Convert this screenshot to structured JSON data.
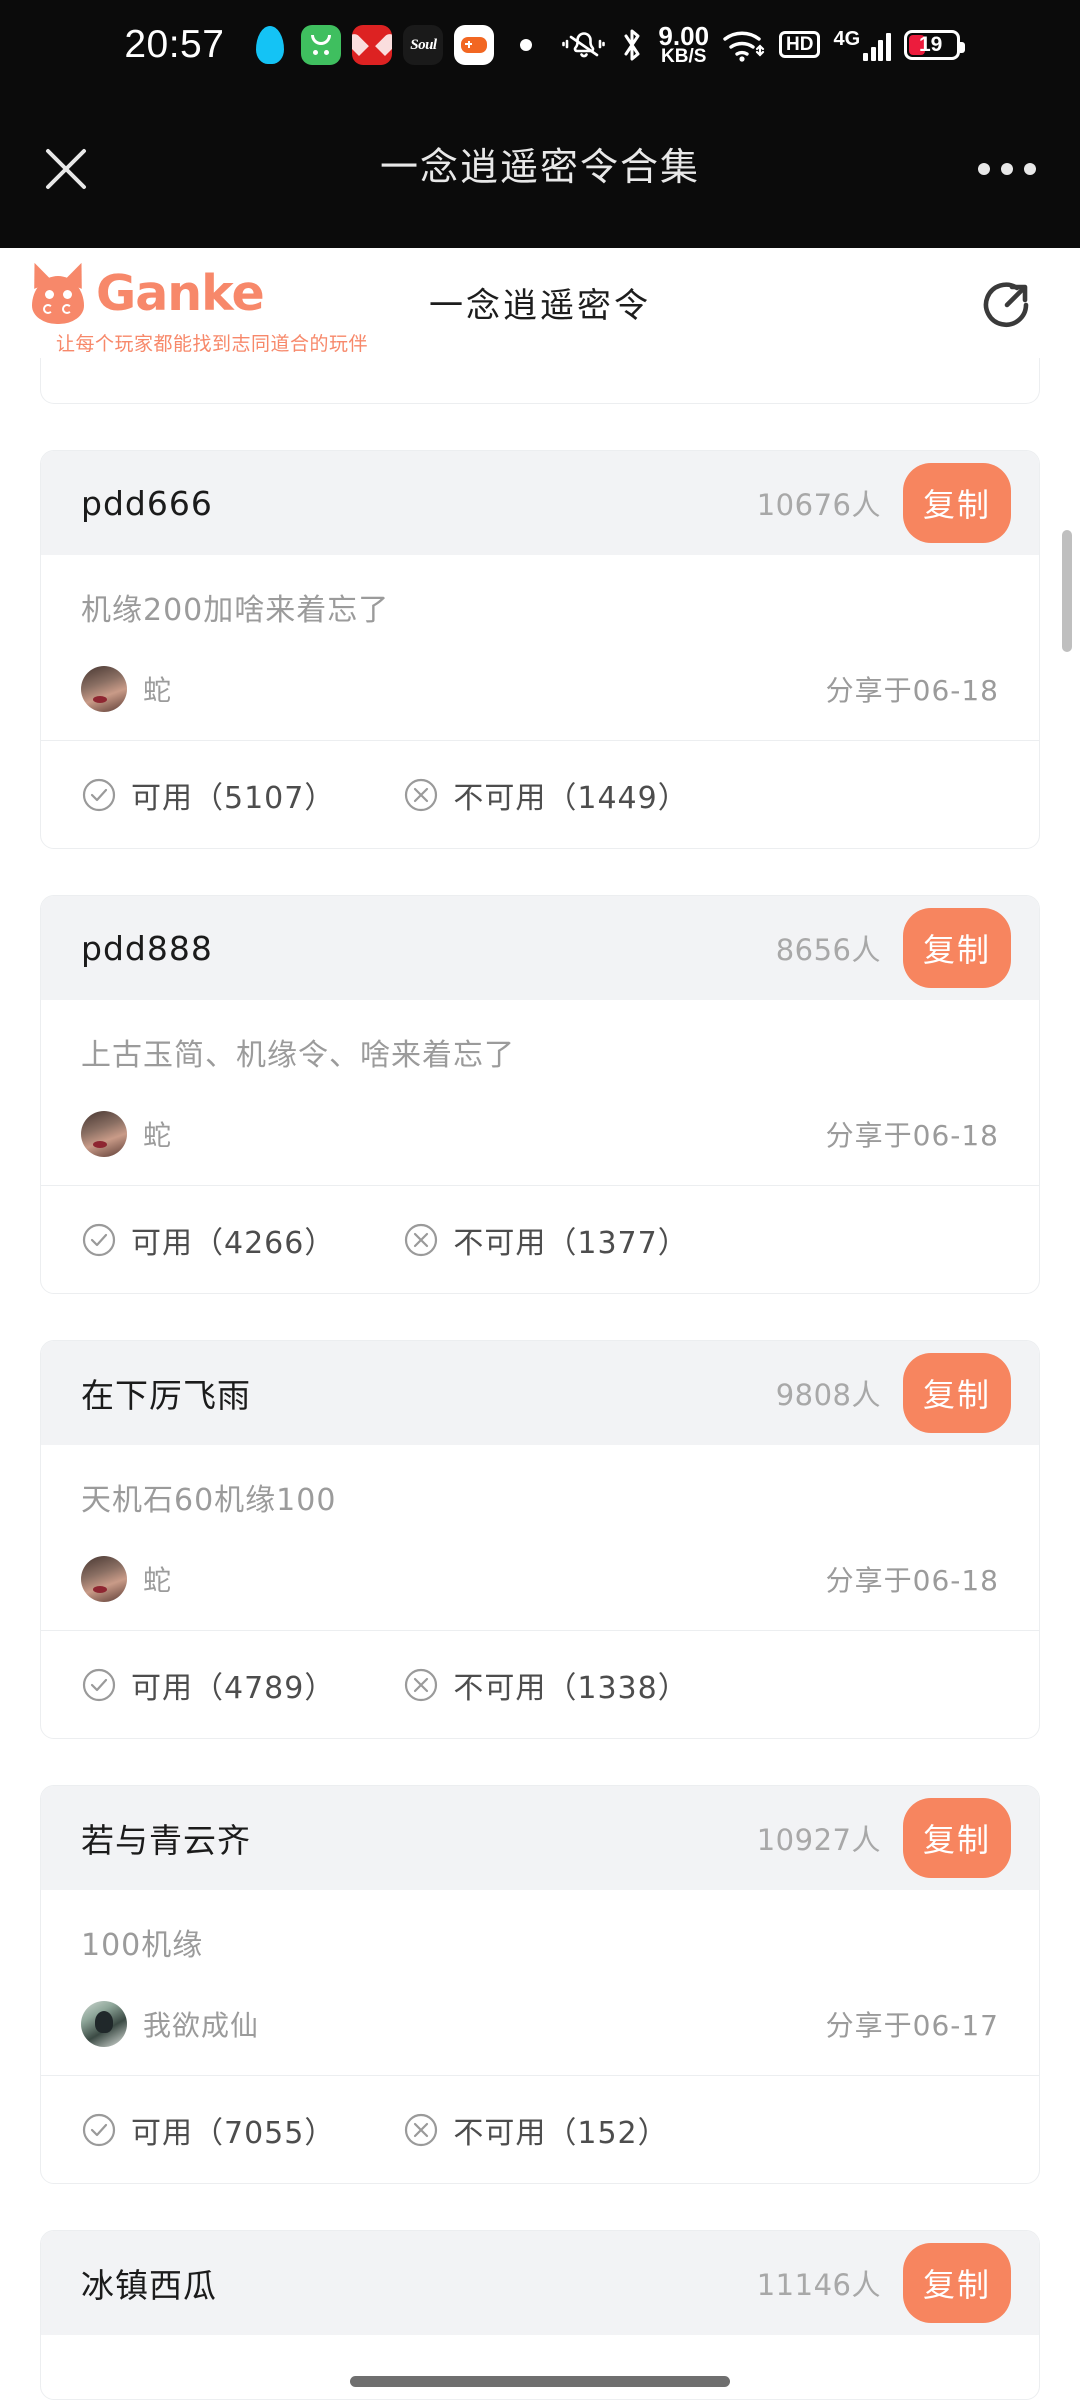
{
  "status_bar": {
    "time": "20:57",
    "app_icons": [
      "qq-icon",
      "wechat-icon",
      "xiaohongshu-icon",
      "soul-icon",
      "game-icon"
    ],
    "soul_label": "Soul",
    "net_speed_value": "9.00",
    "net_speed_unit": "KB/S",
    "hd_label": "HD",
    "network_type": "4G",
    "battery_level": "19",
    "icons": [
      "dot-indicator",
      "mute-bell-icon",
      "bluetooth-icon",
      "wifi-icon",
      "hd-icon",
      "signal-bars-icon",
      "battery-icon"
    ]
  },
  "title_bar": {
    "title": "一念逍遥密令合集",
    "close_icon": "close-icon",
    "more_icon": "more-options-icon"
  },
  "brand_bar": {
    "logo_icon": "ganke-mascot-icon",
    "brand_name": "Ganke",
    "brand_slogan": "让每个玩家都能找到志同道合的玩伴",
    "page_title": "一念逍遥密令",
    "share_icon": "share-icon",
    "accent_color": "#f7886a"
  },
  "labels": {
    "copy_button": "复制",
    "available_prefix": "可用",
    "unavailable_prefix": "不可用",
    "people_suffix": "人",
    "check_icon": "check-circle-icon",
    "cross_icon": "x-circle-icon"
  },
  "cards": [
    {
      "title": "pdd666",
      "count": "10676人",
      "copy": "复制",
      "desc": "机缘200加啥来着忘了",
      "user": "蛇",
      "avatar": "user-avatar-photo",
      "date": "分享于06-18",
      "available": "可用（5107）",
      "unavailable": "不可用（1449）"
    },
    {
      "title": "pdd888",
      "count": "8656人",
      "copy": "复制",
      "desc": "上古玉简、机缘令、啥来着忘了",
      "user": "蛇",
      "avatar": "user-avatar-photo",
      "date": "分享于06-18",
      "available": "可用（4266）",
      "unavailable": "不可用（1377）"
    },
    {
      "title": "在下厉飞雨",
      "count": "9808人",
      "copy": "复制",
      "desc": "天机石60机缘100",
      "user": "蛇",
      "avatar": "user-avatar-photo",
      "date": "分享于06-18",
      "available": "可用（4789）",
      "unavailable": "不可用（1338）"
    },
    {
      "title": "若与青云齐",
      "count": "10927人",
      "copy": "复制",
      "desc": "100机缘",
      "user": "我欲成仙",
      "avatar": "user-avatar-photo",
      "date": "分享于06-17",
      "available": "可用（7055）",
      "unavailable": "不可用（152）"
    },
    {
      "title": "冰镇西瓜",
      "count": "11146人",
      "copy": "复制"
    }
  ]
}
